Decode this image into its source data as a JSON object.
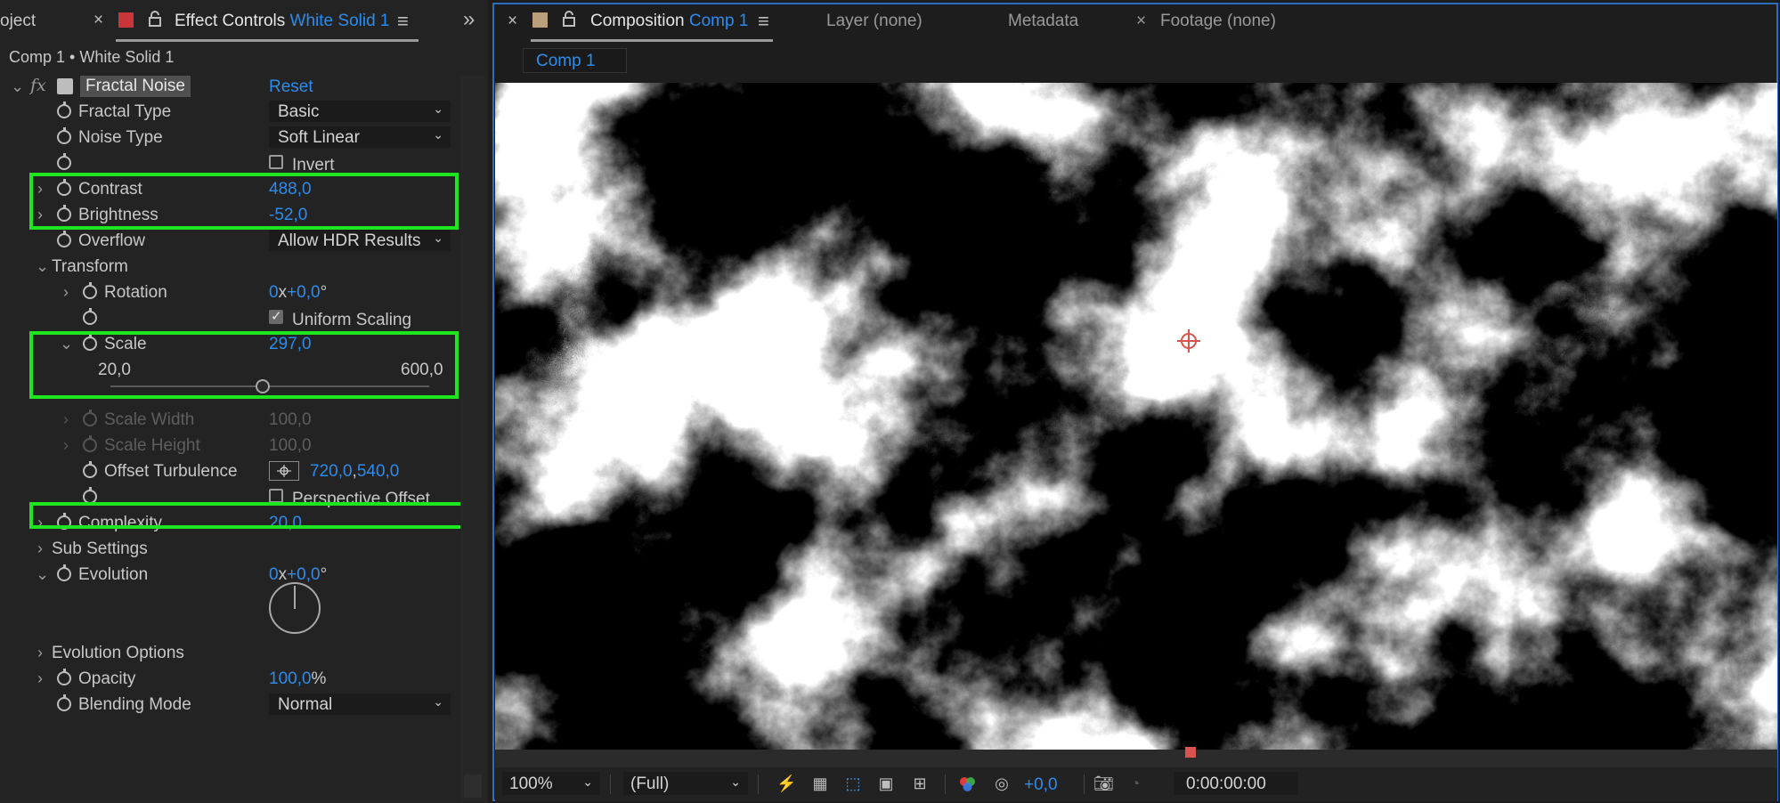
{
  "left_panel": {
    "tabs": {
      "project_partial": "oject",
      "close": "×",
      "effect_controls_label": "Effect Controls",
      "effect_controls_layer": "White Solid 1",
      "menu": "≡",
      "overflow": "»"
    },
    "breadcrumb": "Comp 1 • White Solid 1",
    "effect": {
      "fx": "fx",
      "name": "Fractal Noise",
      "reset": "Reset"
    },
    "properties": {
      "fractal_type": {
        "label": "Fractal Type",
        "value": "Basic"
      },
      "noise_type": {
        "label": "Noise Type",
        "value": "Soft Linear"
      },
      "invert": {
        "label": "Invert",
        "checked": false
      },
      "contrast": {
        "label": "Contrast",
        "value": "488,0"
      },
      "brightness": {
        "label": "Brightness",
        "value": "-52,0"
      },
      "overflow": {
        "label": "Overflow",
        "value": "Allow HDR Results"
      },
      "transform": {
        "label": "Transform"
      },
      "rotation": {
        "label": "Rotation",
        "value_turns": "0",
        "value_x": "x",
        "value_deg": "+0,0",
        "deg_sign": "°"
      },
      "uniform_scaling": {
        "label": "Uniform Scaling",
        "checked": true
      },
      "scale": {
        "label": "Scale",
        "value": "297,0",
        "slider_min": "20,0",
        "slider_max": "600,0",
        "slider_fraction": 0.477
      },
      "scale_width": {
        "label": "Scale Width",
        "value": "100,0"
      },
      "scale_height": {
        "label": "Scale Height",
        "value": "100,0"
      },
      "offset_turbulence": {
        "label": "Offset Turbulence",
        "value_x": "720,0",
        "sep": ",",
        "value_y": "540,0"
      },
      "perspective_offset": {
        "label": "Perspective Offset",
        "checked": false
      },
      "complexity": {
        "label": "Complexity",
        "value": "20,0"
      },
      "sub_settings": {
        "label": "Sub Settings"
      },
      "evolution": {
        "label": "Evolution",
        "value_turns": "0",
        "value_x": "x",
        "value_deg": "+0,0",
        "deg_sign": "°"
      },
      "evolution_options": {
        "label": "Evolution Options"
      },
      "opacity": {
        "label": "Opacity",
        "value": "100,0",
        "unit": "%"
      },
      "blending_mode": {
        "label": "Blending Mode",
        "value": "Normal"
      }
    },
    "colors": {
      "highlight_box": "#1ee61e",
      "value_blue": "#2d8ceb"
    }
  },
  "right_panel": {
    "tabs": {
      "close": "×",
      "composition_label": "Composition",
      "composition_name": "Comp 1",
      "menu": "≡",
      "layer_label": "Layer (none)",
      "metadata_label": "Metadata",
      "footage_close": "×",
      "footage_label": "Footage (none)"
    },
    "comp_subtab": "Comp 1",
    "toolbar": {
      "zoom": "100%",
      "resolution": "(Full)",
      "exposure": "+0,0",
      "timecode": "0:00:00:00"
    }
  }
}
